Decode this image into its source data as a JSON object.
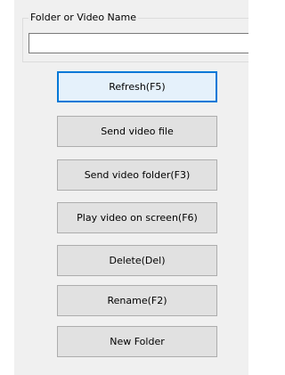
{
  "folder_group": {
    "label": "Folder or Video Name",
    "name_value": "",
    "name_placeholder": ""
  },
  "buttons": {
    "refresh": "Refresh(F5)",
    "send_video_file": "Send video file",
    "send_video_folder": "Send video folder(F3)",
    "play_video_on_screen": "Play video on screen(F6)",
    "delete": "Delete(Del)",
    "rename": "Rename(F2)",
    "new_folder": "New Folder"
  },
  "colors": {
    "panel_background": "#f0f0f0",
    "button_face": "#e1e1e1",
    "button_border": "#adadad",
    "focused_button_face": "#e5f1fb",
    "focus_accent": "#0078d7"
  }
}
